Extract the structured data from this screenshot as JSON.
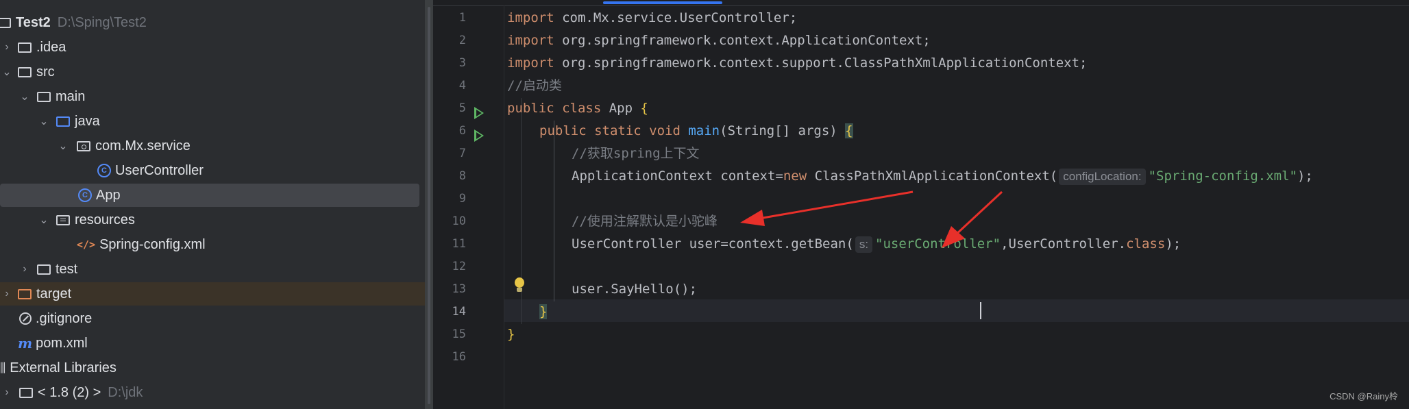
{
  "project": {
    "root": {
      "name": "Test2",
      "path": "D:\\Sping\\Test2"
    },
    "items": [
      {
        "label": ".idea"
      },
      {
        "label": "src"
      },
      {
        "label": "main"
      },
      {
        "label": "java"
      },
      {
        "label": "com.Mx.service"
      },
      {
        "label": "UserController"
      },
      {
        "label": "App"
      },
      {
        "label": "resources"
      },
      {
        "label": "Spring-config.xml"
      },
      {
        "label": "test"
      },
      {
        "label": "target"
      },
      {
        "label": ".gitignore"
      },
      {
        "label": "pom.xml"
      },
      {
        "label": "External Libraries"
      },
      {
        "label": "< 1.8 (2) >",
        "path": "D:\\jdk"
      }
    ],
    "icons": {
      "class": "C",
      "xml": "</>",
      "maven": "m"
    }
  },
  "editor": {
    "line_numbers": [
      "1",
      "2",
      "3",
      "4",
      "5",
      "6",
      "7",
      "8",
      "9",
      "10",
      "11",
      "12",
      "13",
      "14",
      "15",
      "16"
    ],
    "lines": {
      "l1": {
        "kw": "import",
        "rest": " com.Mx.service.UserController;"
      },
      "l2": {
        "kw": "import",
        "rest": " org.springframework.context.ApplicationContext;"
      },
      "l3": {
        "kw": "import",
        "rest": " org.springframework.context.support.ClassPathXmlApplicationContext;"
      },
      "l4": {
        "comment": "//启动类"
      },
      "l5": {
        "kw": "public class",
        "name": " App ",
        "brace": "{"
      },
      "l6": {
        "kw": "public static void",
        "fn": "main",
        "args": "(String[] args) ",
        "brace": "{"
      },
      "l7": {
        "comment": "//获取spring上下文"
      },
      "l8": {
        "a": "ApplicationContext context=",
        "kw": "new",
        "b": " ClassPathXmlApplicationContext(",
        "hint": "configLocation:",
        "str": "\"Spring-config.xml\"",
        "c": ");"
      },
      "l10": {
        "comment": "//使用注解默认是小驼峰"
      },
      "l11": {
        "a": "UserController user=context.getBean(",
        "hint": "s:",
        "str": "\"userController\"",
        "b": ",UserController.",
        "kw": "class",
        "c": ");"
      },
      "l13": {
        "a": "user.SayHello();"
      },
      "l14": {
        "brace": "}"
      },
      "l15": {
        "brace": "}"
      }
    }
  },
  "watermark": "CSDN @Rainy柃",
  "colors": {
    "keyword": "#cf8e6d",
    "comment": "#7a7e85",
    "function": "#56a8f5",
    "string": "#6aab73",
    "annotation_arrow": "#e8302a"
  }
}
